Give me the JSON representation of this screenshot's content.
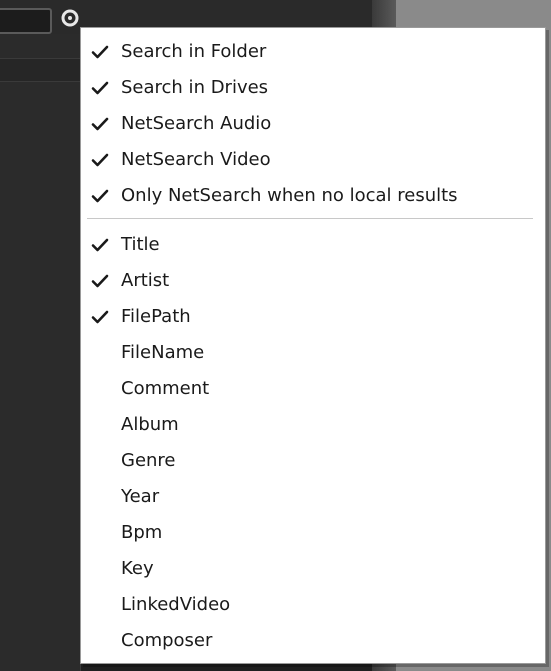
{
  "toolbar": {
    "options_icon": "gear-icon"
  },
  "menu": {
    "check_icon": "checkmark-icon",
    "section_search": [
      {
        "label": "Search in Folder",
        "checked": true
      },
      {
        "label": "Search in Drives",
        "checked": true
      },
      {
        "label": "NetSearch Audio",
        "checked": true
      },
      {
        "label": "NetSearch Video",
        "checked": true
      },
      {
        "label": "Only NetSearch when no local results",
        "checked": true
      }
    ],
    "section_fields": [
      {
        "label": "Title",
        "checked": true
      },
      {
        "label": "Artist",
        "checked": true
      },
      {
        "label": "FilePath",
        "checked": true
      },
      {
        "label": "FileName",
        "checked": false
      },
      {
        "label": "Comment",
        "checked": false
      },
      {
        "label": "Album",
        "checked": false
      },
      {
        "label": "Genre",
        "checked": false
      },
      {
        "label": "Year",
        "checked": false
      },
      {
        "label": "Bpm",
        "checked": false
      },
      {
        "label": "Key",
        "checked": false
      },
      {
        "label": "LinkedVideo",
        "checked": false
      },
      {
        "label": "Composer",
        "checked": false
      }
    ]
  }
}
